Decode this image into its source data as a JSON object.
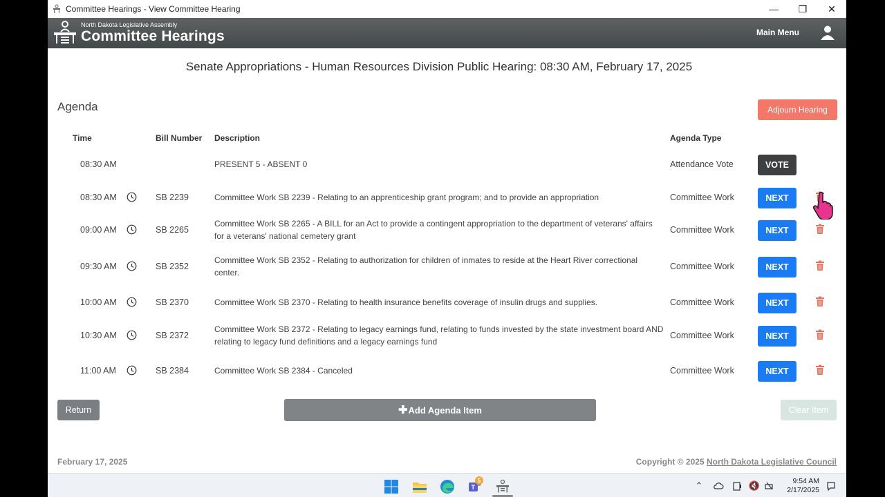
{
  "window": {
    "title": "Committee Hearings - View Committee Hearing"
  },
  "header": {
    "org": "North Dakota Legislative Assembly",
    "app": "Committee Hearings",
    "main_menu": "Main Menu"
  },
  "hearing_title": "Senate Appropriations - Human Resources Division Public Hearing: 08:30 AM, February 17, 2025",
  "agenda": {
    "label": "Agenda",
    "adjourn_label": "Adjourn Hearing",
    "columns": {
      "time": "Time",
      "bill": "Bill Number",
      "description": "Description",
      "type": "Agenda Type"
    },
    "rows": [
      {
        "time": "08:30 AM",
        "bill": "",
        "description": "PRESENT 5 - ABSENT 0",
        "type": "Attendance Vote",
        "action": "VOTE"
      },
      {
        "time": "08:30 AM",
        "bill": "SB 2239",
        "description": "Committee Work SB 2239 - Relating to an apprenticeship grant program; and to provide an appropriation",
        "type": "Committee Work",
        "action": "NEXT"
      },
      {
        "time": "09:00 AM",
        "bill": "SB 2265",
        "description": "Committee Work SB 2265 - A BILL for an Act to provide a contingent appropriation to the department of veterans' affairs for a veterans' national cemetery grant",
        "type": "Committee Work",
        "action": "NEXT"
      },
      {
        "time": "09:30 AM",
        "bill": "SB 2352",
        "description": "Committee Work SB 2352 - Relating to authorization for children of inmates to reside at the Heart River correctional center.",
        "type": "Committee Work",
        "action": "NEXT"
      },
      {
        "time": "10:00 AM",
        "bill": "SB 2370",
        "description": "Committee Work SB 2370 - Relating to health insurance benefits coverage of insulin drugs and supplies.",
        "type": "Committee Work",
        "action": "NEXT"
      },
      {
        "time": "10:30 AM",
        "bill": "SB 2372",
        "description": "Committee Work SB 2372 - Relating to legacy earnings fund, relating to funds invested by the state investment board AND relating to legacy fund definitions and a legacy earnings fund",
        "type": "Committee Work",
        "action": "NEXT"
      },
      {
        "time": "11:00 AM",
        "bill": "SB 2384",
        "description": "Committee Work SB 2384 - Canceled",
        "type": "Committee Work",
        "action": "NEXT"
      }
    ]
  },
  "buttons": {
    "return": "Return",
    "add": "Add Agenda Item",
    "clear": "Clear Item"
  },
  "footer": {
    "date": "February 17, 2025",
    "copyright_prefix": "Copyright © 2025 ",
    "copyright_link": "North Dakota Legislative Council"
  },
  "taskbar": {
    "time": "9:54 AM",
    "date": "2/17/2025",
    "teams_badge": "5"
  },
  "colors": {
    "header": "#4c5153",
    "next": "#1a7bf2",
    "vote": "#3d3f41",
    "adjourn": "#f4786a",
    "trash": "#e8735f"
  }
}
